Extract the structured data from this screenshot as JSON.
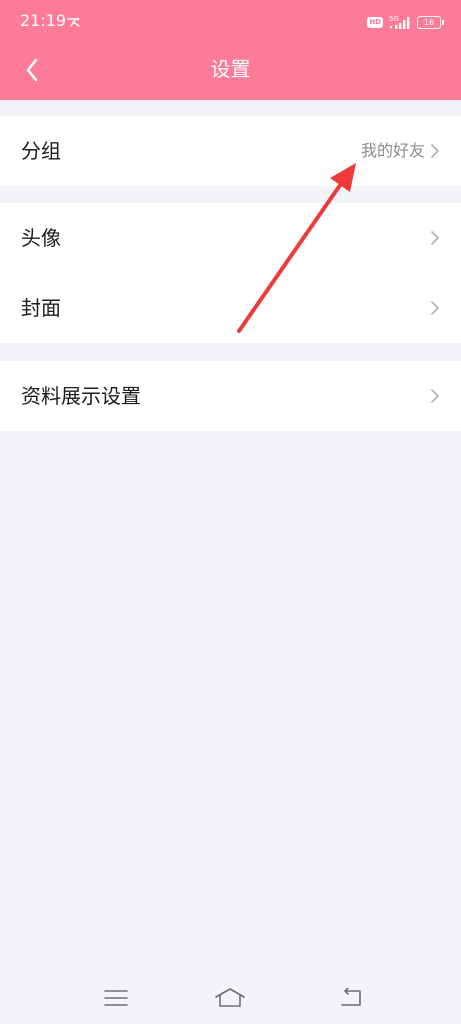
{
  "status_bar": {
    "time": "21:19",
    "hd_label": "HD",
    "network_label": "5G",
    "battery_level": "16"
  },
  "header": {
    "title": "设置",
    "back_icon": "chevron-left-icon"
  },
  "settings": {
    "group_row": {
      "label": "分组",
      "value": "我的好友"
    },
    "avatar_row": {
      "label": "头像"
    },
    "cover_row": {
      "label": "封面"
    },
    "profile_display_row": {
      "label": "资料展示设置"
    }
  },
  "nav": {
    "menu_icon": "menu-icon",
    "home_icon": "home-icon",
    "back_icon": "back-icon"
  },
  "colors": {
    "accent": "#fd7b96",
    "background": "#f3f4f8",
    "annotation_arrow": "#ec3b3b"
  }
}
